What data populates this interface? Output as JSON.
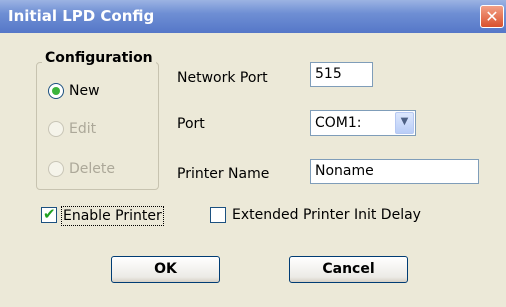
{
  "window": {
    "title": "Initial LPD Config",
    "close_glyph": "✕"
  },
  "configuration": {
    "title": "Configuration",
    "options": [
      {
        "label": "New",
        "selected": true,
        "enabled": true
      },
      {
        "label": "Edit",
        "selected": false,
        "enabled": false
      },
      {
        "label": "Delete",
        "selected": false,
        "enabled": false
      }
    ]
  },
  "fields": {
    "network_port": {
      "label": "Network Port",
      "value": "515"
    },
    "port": {
      "label": "Port",
      "value": "COM1:"
    },
    "printer_name": {
      "label": "Printer Name",
      "value": "Noname"
    }
  },
  "checkboxes": {
    "enable_printer": {
      "label": "Enable Printer",
      "checked": true
    },
    "extended_delay": {
      "label": "Extended Printer Init Delay",
      "checked": false
    }
  },
  "buttons": {
    "ok": "OK",
    "cancel": "Cancel"
  },
  "colors": {
    "title_bar": "#6f8fd4",
    "close_button": "#d9512d",
    "radio_selected": "#3bb33b",
    "check_mark": "#21a121"
  }
}
